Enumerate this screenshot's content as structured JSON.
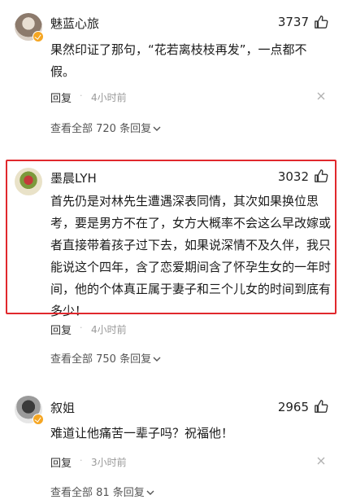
{
  "comments": [
    {
      "username": "魅蓝心旅",
      "likes": "3737",
      "text": "果然印证了那句，“花若离枝枝再发”，一点都不假。",
      "reply_label": "回复",
      "dot": "·",
      "time": "4小时前",
      "view_all": "查看全部 720 条回复"
    },
    {
      "username": "墨晨LYH",
      "likes": "3032",
      "text": "首先仍是对林先生遭遇深表同情，其次如果换位思考，要是男方不在了，女方大概率不会这么早改嫁或者直接带着孩子过下去，如果说深情不及久伴，我只能说这个四年，含了恋爱期间含了怀孕生女的一年时间，他的个体真正属于妻子和三个儿女的时间到底有多少！",
      "reply_label": "回复",
      "dot": "·",
      "time": "4小时前",
      "view_all": "查看全部 750 条回复",
      "highlighted": true,
      "highlight_color": "#e0282d"
    },
    {
      "username": "叙姐",
      "likes": "2965",
      "text": "难道让他痛苦一辈子吗？祝福他！",
      "reply_label": "回复",
      "dot": "·",
      "time": "3小时前",
      "view_all": "查看全部 81 条回复"
    }
  ]
}
